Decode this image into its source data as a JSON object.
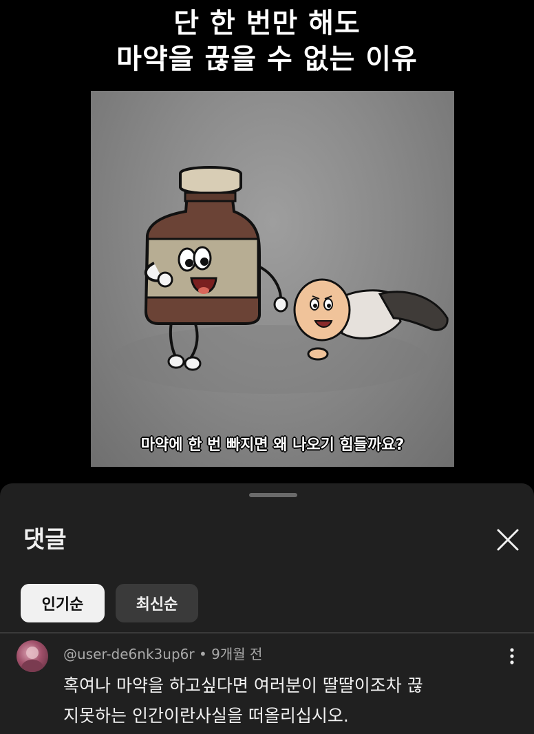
{
  "video": {
    "title_line1": "단 한 번만 해도",
    "title_line2": "마약을 끊을 수 없는 이유",
    "caption": "마약에 한 번 빠지면 왜 나오기 힘들까요?"
  },
  "comments_panel": {
    "title": "댓글",
    "close_icon": "close-icon",
    "sort_tabs": [
      {
        "label": "인기순",
        "active": true
      },
      {
        "label": "최신순",
        "active": false
      }
    ],
    "comment": {
      "author": "@user-de6nk3up6r",
      "separator": "•",
      "time": "9개월 전",
      "text_line1": "혹여나 마약을 하고싶다면 여러분이 딸딸이조차 끊",
      "text_line2": "지못하는 인간이란사실을 떠올리십시오."
    }
  },
  "colors": {
    "background": "#000000",
    "sheet": "#202020",
    "chip_active": "#f1f1f1",
    "chip_inactive": "#3a3a3a",
    "meta_text": "#aaaaaa"
  }
}
